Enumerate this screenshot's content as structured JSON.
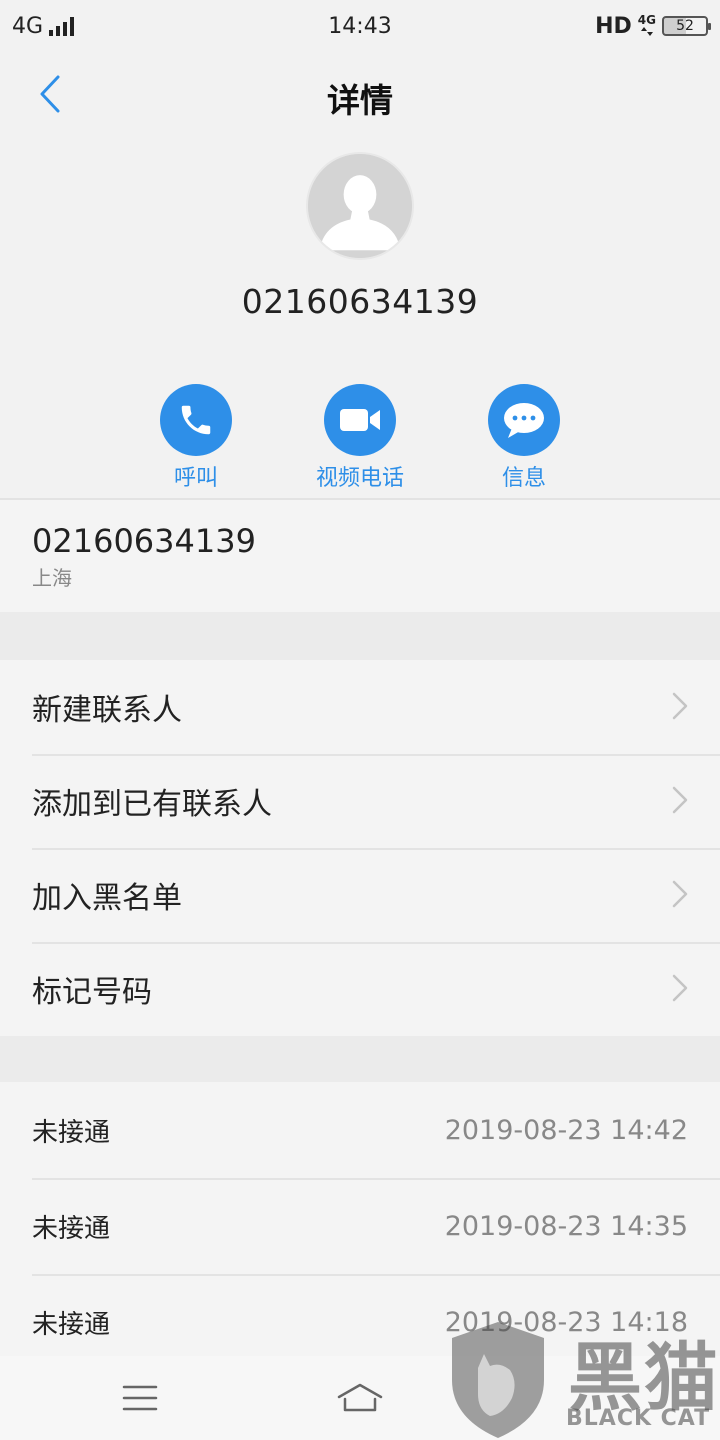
{
  "status_bar": {
    "network": "4G",
    "time": "14:43",
    "hd": "HD",
    "net_mini": "4G",
    "battery_level": 52,
    "battery_text": "52"
  },
  "header": {
    "title": "详情"
  },
  "contact": {
    "number": "02160634139"
  },
  "actions": [
    {
      "label": "呼叫",
      "icon": "phone-icon"
    },
    {
      "label": "视频电话",
      "icon": "video-camera-icon"
    },
    {
      "label": "信息",
      "icon": "message-bubble-icon"
    }
  ],
  "number_info": {
    "number": "02160634139",
    "location": "上海"
  },
  "menu": {
    "items": [
      {
        "label": "新建联系人"
      },
      {
        "label": "添加到已有联系人"
      },
      {
        "label": "加入黑名单"
      },
      {
        "label": "标记号码"
      }
    ]
  },
  "call_log": [
    {
      "status": "未接通",
      "time": "2019-08-23 14:42"
    },
    {
      "status": "未接通",
      "time": "2019-08-23 14:35"
    },
    {
      "status": "未接通",
      "time": "2019-08-23 14:18"
    }
  ],
  "watermark": {
    "text": "黑猫",
    "subtext": "BLACK CAT"
  },
  "colors": {
    "accent": "#2e8fe8",
    "background": "#f2f2f2",
    "secondary_text": "#888888"
  }
}
